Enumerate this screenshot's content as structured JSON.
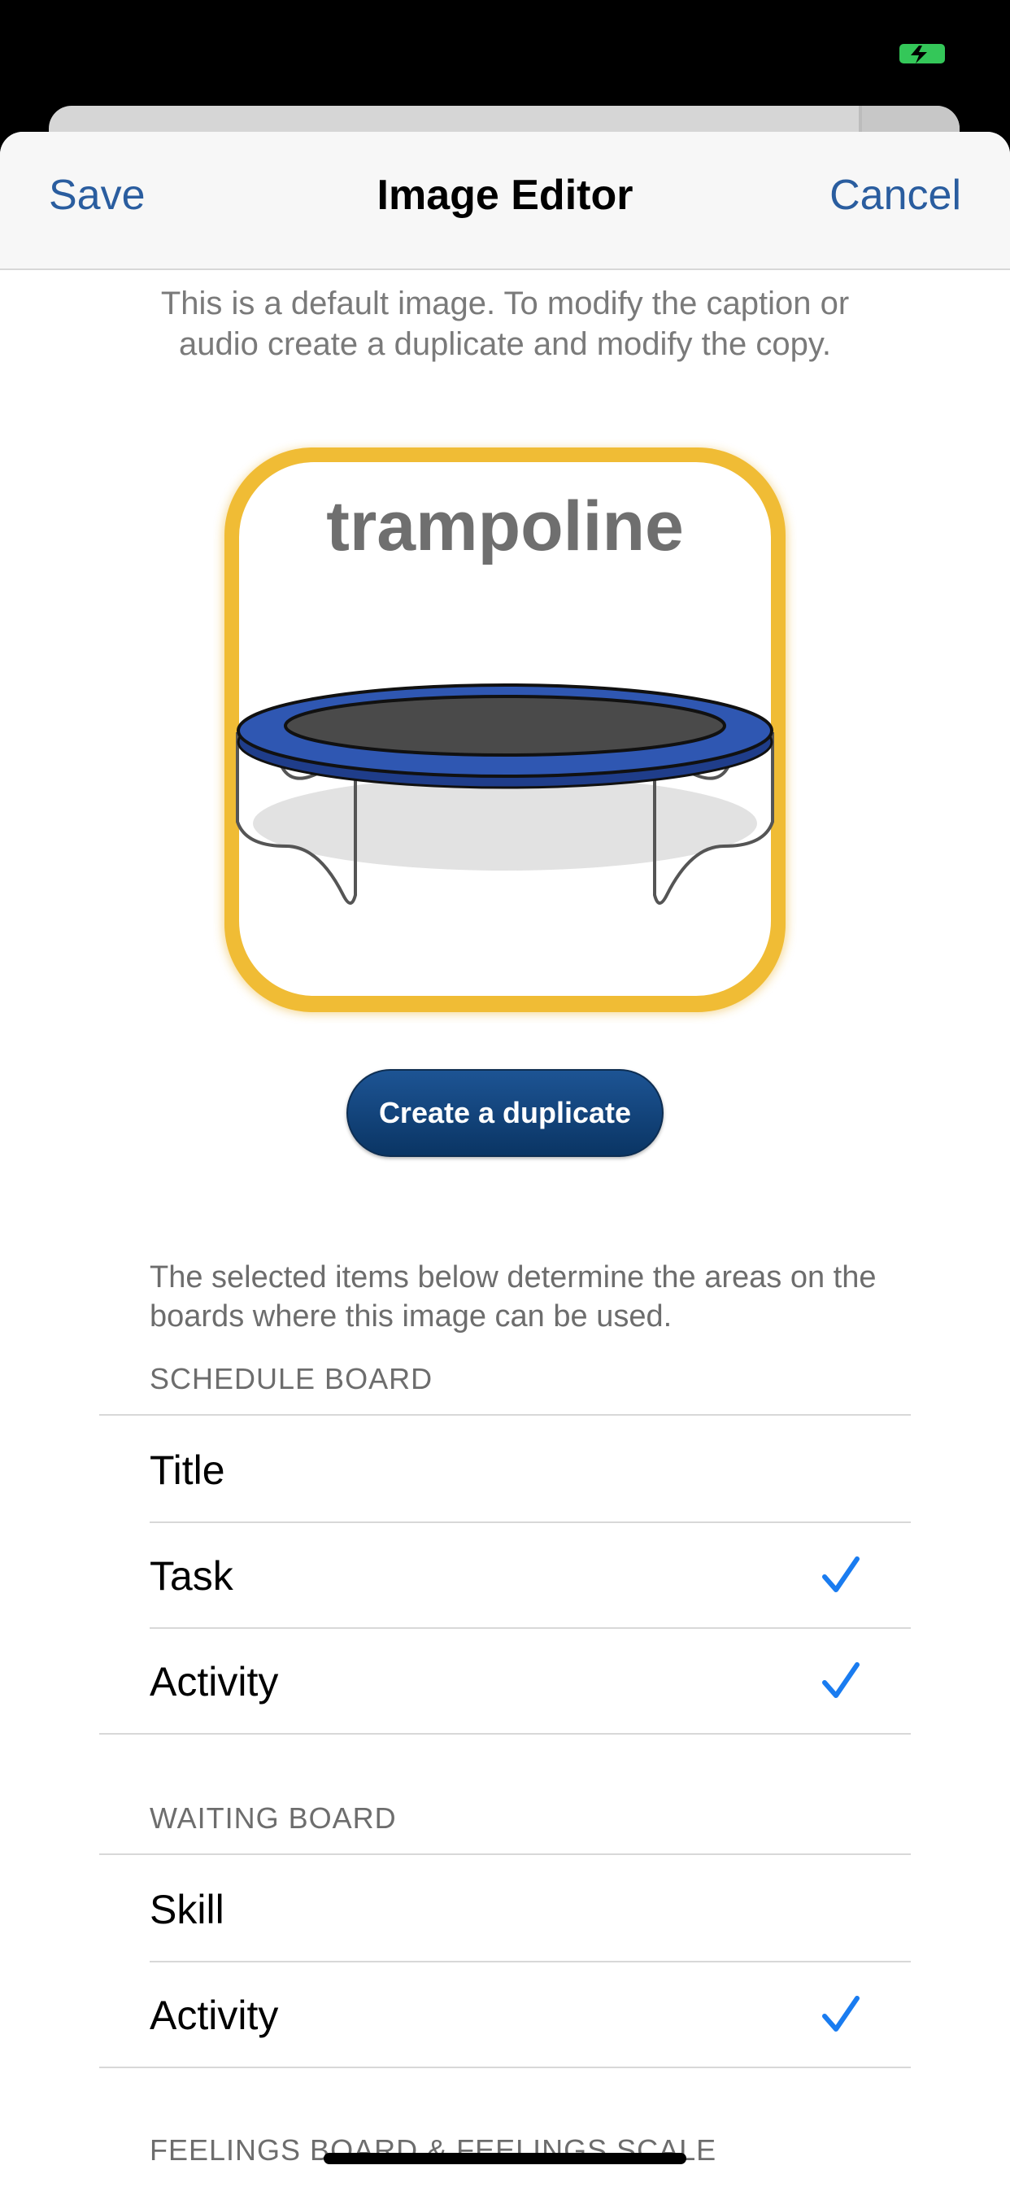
{
  "nav": {
    "save_label": "Save",
    "title": "Image Editor",
    "cancel_label": "Cancel"
  },
  "info_text": "This is a default image.  To modify the caption or audio create a duplicate and modify the copy.",
  "image": {
    "caption": "trampoline",
    "icon": "trampoline-picture",
    "border_color": "#f0bc35"
  },
  "duplicate_button_label": "Create a duplicate",
  "usage_text": "The selected items below determine the areas on the boards where this image can be used.",
  "sections": [
    {
      "header": "SCHEDULE BOARD",
      "rows": [
        {
          "label": "Title",
          "checked": false
        },
        {
          "label": "Task",
          "checked": true
        },
        {
          "label": "Activity",
          "checked": true
        }
      ]
    },
    {
      "header": "WAITING BOARD",
      "rows": [
        {
          "label": "Skill",
          "checked": false
        },
        {
          "label": "Activity",
          "checked": true
        }
      ]
    },
    {
      "header": "FEELINGS BOARD & FEELINGS SCALE",
      "rows": []
    }
  ],
  "colors": {
    "accent": "#2a5d9f",
    "checkmark": "#1a7cf0",
    "button": "#0f3d73"
  }
}
